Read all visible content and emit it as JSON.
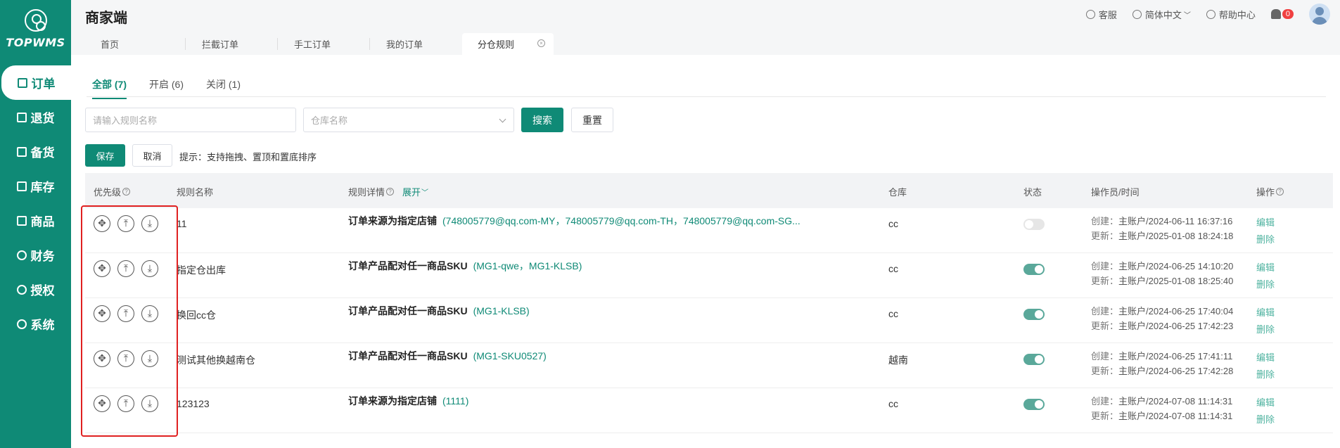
{
  "brand": {
    "logo_text": "TOPWMS",
    "title": "商家端"
  },
  "sidebar": {
    "items": [
      {
        "label": "订单",
        "icon": "order-icon"
      },
      {
        "label": "退货",
        "icon": "return-icon"
      },
      {
        "label": "备货",
        "icon": "stock-prep-icon"
      },
      {
        "label": "库存",
        "icon": "inventory-icon"
      },
      {
        "label": "商品",
        "icon": "product-icon"
      },
      {
        "label": "财务",
        "icon": "finance-icon"
      },
      {
        "label": "授权",
        "icon": "authorize-icon"
      },
      {
        "label": "系统",
        "icon": "settings-icon"
      }
    ]
  },
  "header": {
    "service": "客服",
    "language": "简体中文",
    "help": "帮助中心",
    "notifications": "0"
  },
  "tabs": [
    {
      "label": "首页"
    },
    {
      "label": "拦截订单"
    },
    {
      "label": "手工订单"
    },
    {
      "label": "我的订单"
    },
    {
      "label": "分仓规则"
    }
  ],
  "filter_tabs": [
    {
      "label": "全部 (7)"
    },
    {
      "label": "开启 (6)"
    },
    {
      "label": "关闭 (1)"
    }
  ],
  "search": {
    "name_placeholder": "请输入规则名称",
    "warehouse_placeholder": "仓库名称",
    "search_label": "搜索",
    "reset_label": "重置"
  },
  "actions": {
    "save_label": "保存",
    "cancel_label": "取消",
    "hint": "提示：支持拖拽、置顶和置底排序"
  },
  "table": {
    "columns": {
      "priority": "优先级",
      "name": "规则名称",
      "detail": "规则详情",
      "expand": "展开",
      "warehouse": "仓库",
      "status": "状态",
      "operator": "操作员/时间",
      "action": "操作"
    },
    "edit_label": "编辑",
    "delete_label": "删除",
    "created_prefix": "创建：",
    "updated_prefix": "更新：",
    "rows": [
      {
        "name": "11",
        "detail_title": "订单来源为指定店铺",
        "detail_value": "(748005779@qq.com-MY，748005779@qq.com-TH，748005779@qq.com-SG...",
        "warehouse": "cc",
        "enabled": false,
        "created": "主账户/2024-06-11 16:37:16",
        "updated": "主账户/2025-01-08 18:24:18"
      },
      {
        "name": "指定仓出库",
        "detail_title": "订单产品配对任一商品SKU",
        "detail_value": "(MG1-qwe，MG1-KLSB)",
        "warehouse": "cc",
        "enabled": true,
        "created": "主账户/2024-06-25 14:10:20",
        "updated": "主账户/2025-01-08 18:25:40"
      },
      {
        "name": "换回cc仓",
        "detail_title": "订单产品配对任一商品SKU",
        "detail_value": "(MG1-KLSB)",
        "warehouse": "cc",
        "enabled": true,
        "created": "主账户/2024-06-25 17:40:04",
        "updated": "主账户/2024-06-25 17:42:23"
      },
      {
        "name": "测试其他换越南仓",
        "detail_title": "订单产品配对任一商品SKU",
        "detail_value": "(MG1-SKU0527)",
        "warehouse": "越南",
        "enabled": true,
        "created": "主账户/2024-06-25 17:41:11",
        "updated": "主账户/2024-06-25 17:42:28"
      },
      {
        "name": "123123",
        "detail_title": "订单来源为指定店铺",
        "detail_value": "(1111)",
        "warehouse": "cc",
        "enabled": true,
        "created": "主账户/2024-07-08 11:14:31",
        "updated": "主账户/2024-07-08 11:14:31"
      }
    ]
  },
  "colors": {
    "brand": "#0f8a76",
    "highlight": "#e02020"
  }
}
